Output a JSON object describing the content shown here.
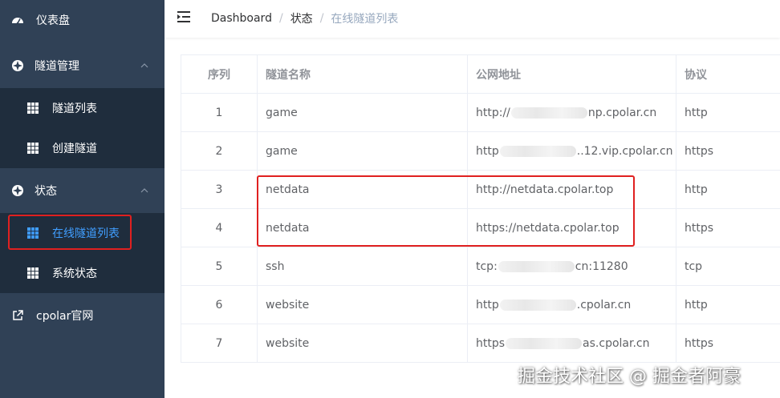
{
  "sidebar": {
    "dashboard_label": "仪表盘",
    "tunnel_mgmt_label": "隧道管理",
    "tunnel_list_label": "隧道列表",
    "create_tunnel_label": "创建隧道",
    "status_label": "状态",
    "online_tunnels_label": "在线隧道列表",
    "system_status_label": "系统状态",
    "website_label": "cpolar官网"
  },
  "header": {
    "breadcrumb": [
      "Dashboard",
      "状态",
      "在线隧道列表"
    ],
    "separator": "/"
  },
  "table": {
    "headers": [
      "序列",
      "隧道名称",
      "公网地址",
      "协议"
    ],
    "rows": [
      {
        "idx": "1",
        "name": "game",
        "addr_pre": "http://",
        "addr_post": "np.cpolar.cn",
        "proto": "http"
      },
      {
        "idx": "2",
        "name": "game",
        "addr_pre": "http",
        "addr_post": "..12.vip.cpolar.cn",
        "proto": "https"
      },
      {
        "idx": "3",
        "name": "netdata",
        "addr_pre": "http://netdata.cpolar.top",
        "addr_post": "",
        "proto": "http"
      },
      {
        "idx": "4",
        "name": "netdata",
        "addr_pre": "https://netdata.cpolar.top",
        "addr_post": "",
        "proto": "https"
      },
      {
        "idx": "5",
        "name": "ssh",
        "addr_pre": "tcp:",
        "addr_post": "cn:11280",
        "proto": "tcp"
      },
      {
        "idx": "6",
        "name": "website",
        "addr_pre": "http",
        "addr_post": ".cpolar.cn",
        "proto": "http"
      },
      {
        "idx": "7",
        "name": "website",
        "addr_pre": "https",
        "addr_post": "as.cpolar.cn",
        "proto": "https"
      }
    ]
  },
  "watermark": "掘金技术社区 @ 掘金者阿豪",
  "colors": {
    "sidebar_bg": "#304156",
    "submenu_bg": "#1f2d3d",
    "active_text": "#409eff",
    "highlight_red": "#e02020"
  },
  "icons": {
    "dashboard": "dashboard-icon",
    "tunnel_mgmt": "tunnel-icon",
    "status": "status-icon",
    "list": "grid-icon",
    "external": "external-link-icon",
    "menu": "hamburger-icon",
    "chevron": "chevron-up-icon"
  }
}
